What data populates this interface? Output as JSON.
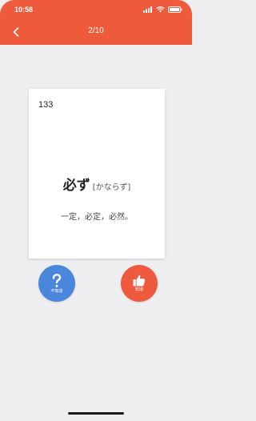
{
  "status_bar": {
    "time": "10:58"
  },
  "nav": {
    "title": "2/10",
    "back_icon": "chevron-left-icon"
  },
  "card": {
    "number": "133",
    "word": "必ず",
    "reading": "[かならず]",
    "meaning": "一定，必定，必然。"
  },
  "buttons": {
    "unknown": {
      "icon": "question-icon",
      "label": "不知道",
      "color": "#4a86db"
    },
    "known": {
      "icon": "thumbs-up-icon",
      "label": "知道",
      "color": "#ef5a3f"
    }
  },
  "colors": {
    "header": "#f05a3c",
    "background": "#eeeef0"
  }
}
